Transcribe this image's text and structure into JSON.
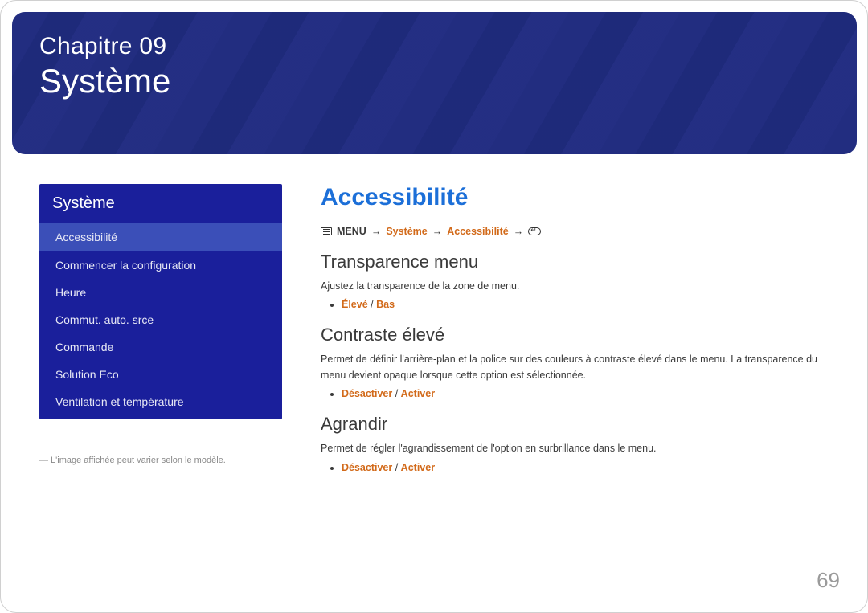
{
  "banner": {
    "chapter_line": "Chapitre 09",
    "title": "Système"
  },
  "sidebar": {
    "header": "Système",
    "items": [
      {
        "label": "Accessibilité",
        "active": true
      },
      {
        "label": "Commencer la configuration",
        "active": false
      },
      {
        "label": "Heure",
        "active": false
      },
      {
        "label": "Commut. auto. srce",
        "active": false
      },
      {
        "label": "Commande",
        "active": false
      },
      {
        "label": "Solution Eco",
        "active": false
      },
      {
        "label": "Ventilation et température",
        "active": false
      }
    ],
    "note": "― L'image affichée peut varier selon le modèle."
  },
  "main": {
    "title": "Accessibilité",
    "breadcrumb": {
      "menu_label": "MENU",
      "arrow": "→",
      "p1": "Système",
      "p2": "Accessibilité"
    },
    "sections": [
      {
        "heading": "Transparence menu",
        "body": "Ajustez la transparence de la zone de menu.",
        "options_1": "Élevé",
        "options_sep": " / ",
        "options_2": "Bas"
      },
      {
        "heading": "Contraste élevé",
        "body": "Permet de définir l'arrière-plan et la police sur des couleurs à contraste élevé dans le menu. La transparence du menu devient opaque lorsque cette option est sélectionnée.",
        "options_1": "Désactiver",
        "options_sep": " / ",
        "options_2": "Activer"
      },
      {
        "heading": "Agrandir",
        "body": "Permet de régler l'agrandissement de l'option en surbrillance dans le menu.",
        "options_1": "Désactiver",
        "options_sep": " / ",
        "options_2": "Activer"
      }
    ]
  },
  "page_number": "69"
}
